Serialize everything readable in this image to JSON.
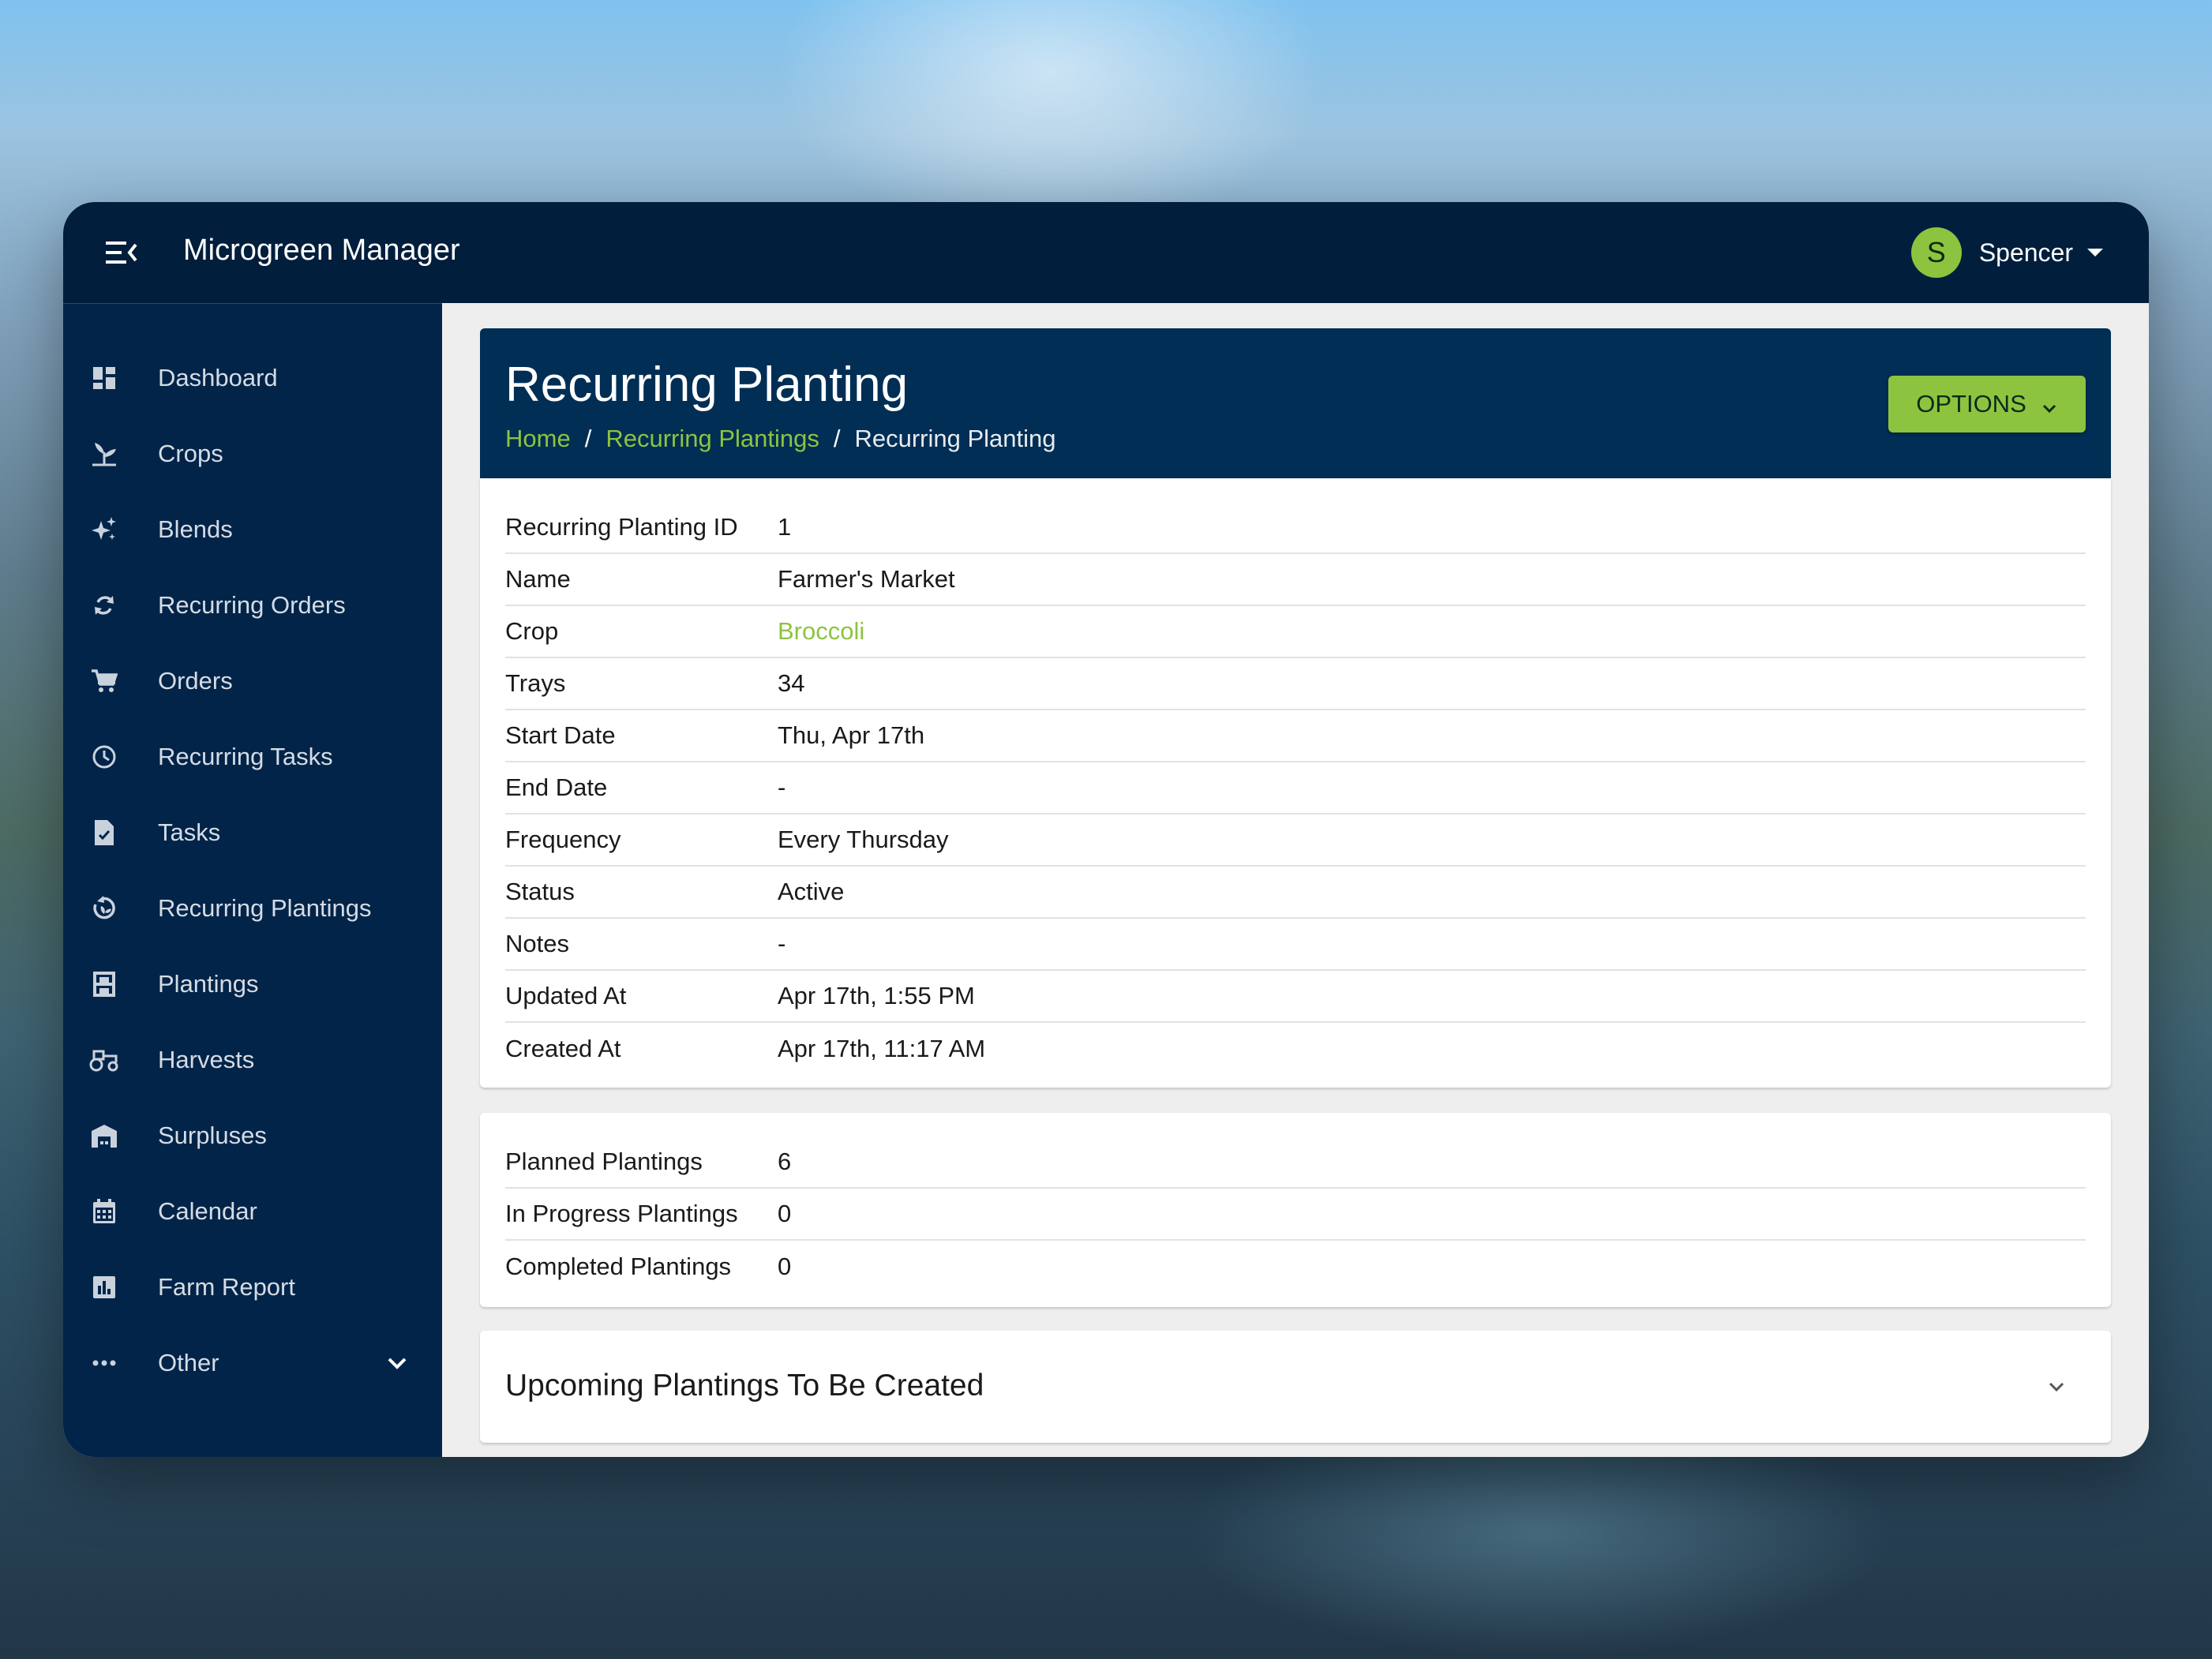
{
  "app": {
    "title": "Microgreen Manager"
  },
  "user": {
    "initial": "S",
    "name": "Spencer"
  },
  "sidebar": {
    "items": [
      {
        "label": "Dashboard",
        "icon": "dashboard-icon"
      },
      {
        "label": "Crops",
        "icon": "sprout-icon"
      },
      {
        "label": "Blends",
        "icon": "sparkles-icon"
      },
      {
        "label": "Recurring Orders",
        "icon": "refresh-icon"
      },
      {
        "label": "Orders",
        "icon": "cart-icon"
      },
      {
        "label": "Recurring Tasks",
        "icon": "clock-icon"
      },
      {
        "label": "Tasks",
        "icon": "task-file-icon"
      },
      {
        "label": "Recurring Plantings",
        "icon": "recurring-planting-icon"
      },
      {
        "label": "Plantings",
        "icon": "shelf-icon"
      },
      {
        "label": "Harvests",
        "icon": "tractor-icon"
      },
      {
        "label": "Surpluses",
        "icon": "warehouse-icon"
      },
      {
        "label": "Calendar",
        "icon": "calendar-icon"
      },
      {
        "label": "Farm Report",
        "icon": "report-icon"
      },
      {
        "label": "Other",
        "icon": "more-icon"
      }
    ]
  },
  "header": {
    "title": "Recurring Planting",
    "breadcrumb": [
      "Home",
      "Recurring Plantings",
      "Recurring Planting"
    ],
    "options_label": "OPTIONS"
  },
  "details": [
    {
      "label": "Recurring Planting ID",
      "value": "1"
    },
    {
      "label": "Name",
      "value": "Farmer's Market"
    },
    {
      "label": "Crop",
      "value": "Broccoli"
    },
    {
      "label": "Trays",
      "value": "34"
    },
    {
      "label": "Start Date",
      "value": "Thu, Apr 17th"
    },
    {
      "label": "End Date",
      "value": "-"
    },
    {
      "label": "Frequency",
      "value": "Every Thursday"
    },
    {
      "label": "Status",
      "value": "Active"
    },
    {
      "label": "Notes",
      "value": "-"
    },
    {
      "label": "Updated At",
      "value": "Apr 17th, 1:55 PM"
    },
    {
      "label": "Created At",
      "value": "Apr 17th, 11:17 AM"
    }
  ],
  "counts": [
    {
      "label": "Planned Plantings",
      "value": "6"
    },
    {
      "label": "In Progress Plantings",
      "value": "0"
    },
    {
      "label": "Completed Plantings",
      "value": "0"
    }
  ],
  "upcoming": {
    "title": "Upcoming Plantings To Be Created"
  },
  "colors": {
    "appbar": "#011e3c",
    "sidebar": "#022449",
    "header_card": "#002e55",
    "accent": "#8cc43f"
  }
}
